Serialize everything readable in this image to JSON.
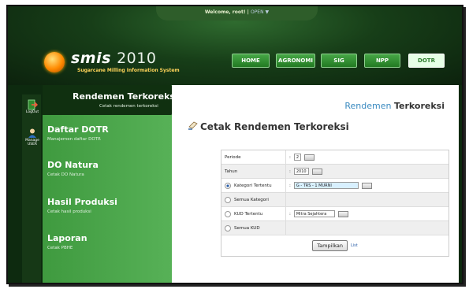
{
  "header": {
    "welcome": "Welcome, root! |",
    "option": "OPEN ▼",
    "logo_name": "smis",
    "logo_year": "2010",
    "logo_sub": "Sugarcane Milling Information System"
  },
  "nav": [
    {
      "label": "HOME",
      "active": false
    },
    {
      "label": "AGRONOMI",
      "active": false
    },
    {
      "label": "SIG",
      "active": false
    },
    {
      "label": "NPP",
      "active": false
    },
    {
      "label": "DOTR",
      "active": true
    }
  ],
  "leftbar": {
    "logout": "LogOut",
    "manage_1": "Manage",
    "manage_2": "USER"
  },
  "sidebar": {
    "items": [
      {
        "title": "Rendemen Terkoreksi",
        "sub": "Cetak rendemen terkoreksi"
      },
      {
        "title": "Daftar DOTR",
        "sub": "Manajemen daftar DOTR"
      },
      {
        "title": "DO Natura",
        "sub": "Cetak DO Natura"
      },
      {
        "title": "Hasil Produksi",
        "sub": "Cetak hasil produksi"
      },
      {
        "title": "Laporan",
        "sub": "Cetak PBHE"
      }
    ]
  },
  "content": {
    "crumb_a": "Rendemen ",
    "crumb_b": "Terkoreksi",
    "title": "Cetak Rendemen Terkoreksi"
  },
  "form": {
    "periode_label": "Periode",
    "periode_value": "2",
    "tahun_label": "Tahun",
    "tahun_value": "2010",
    "kategori_label": "Kategori Tertentu",
    "kategori_value": "G - TRS - 1 MURNI",
    "semua_kategori": "Semua Kategori",
    "kud_label": "KUD Tertentu",
    "kud_value": "Mitra Sejahtera",
    "semua_kud": "Semua KUD",
    "colon": ":",
    "submit": "Tampilkan",
    "list_link": "List"
  }
}
